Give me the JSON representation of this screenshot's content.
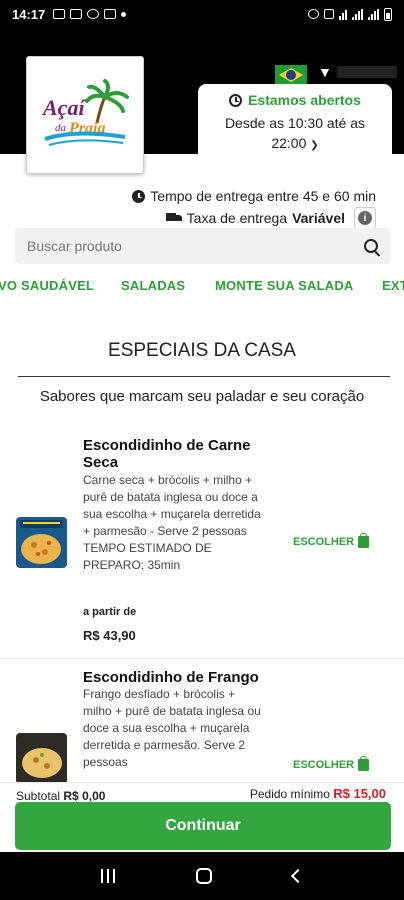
{
  "status_bar": {
    "time": "14:17"
  },
  "store": {
    "logo_text": "Açaí da Praia",
    "logo_subtext": "",
    "status": "Estamos abertos",
    "hours_line1": "Desde as 10:30 até as",
    "hours_line2": "22:00",
    "delivery_time": "Tempo de entrega entre 45 e 60 min",
    "delivery_fee_label": "Taxa de entrega",
    "delivery_fee_value": "Variável",
    "language_flag": "brazil-flag"
  },
  "search": {
    "placeholder": "Buscar produto"
  },
  "categories": [
    "VO SAUDÁVEL",
    "SALADAS",
    "MONTE SUA SALADA",
    "EXT"
  ],
  "section": {
    "title": "ESPECIAIS DA CASA",
    "subtitle": "Sabores que marcam seu paladar e seu coração"
  },
  "products": [
    {
      "name": "Escondidinho de Carne Seca",
      "description": "Carne seca + brócolis + milho + purê de batata inglesa ou doce a sua escolha + muçarela derretida + parmesão - Serve 2 pessoas TEMPO ESTIMADO DE PREPARO: 35min",
      "from_label": "a partir de",
      "price": "R$ 43,90",
      "choose_label": "ESCOLHER"
    },
    {
      "name": "Escondidinho de Frango",
      "description": "Frango desfiado + brócolis + milho + purê de batata inglesa ou doce a sua escolha + muçarela derretida e parmesão. Serve 2 pessoas",
      "choose_label": "ESCOLHER"
    }
  ],
  "footer": {
    "subtotal_label": "Subtotal",
    "subtotal_value": "R$ 0,00",
    "minimum_label": "Pedido mínimo",
    "minimum_value": "R$ 15,00",
    "continue_label": "Continuar"
  },
  "colors": {
    "accent": "#34a640",
    "green_text": "#2e9e3a",
    "min_red": "#d6202a"
  }
}
